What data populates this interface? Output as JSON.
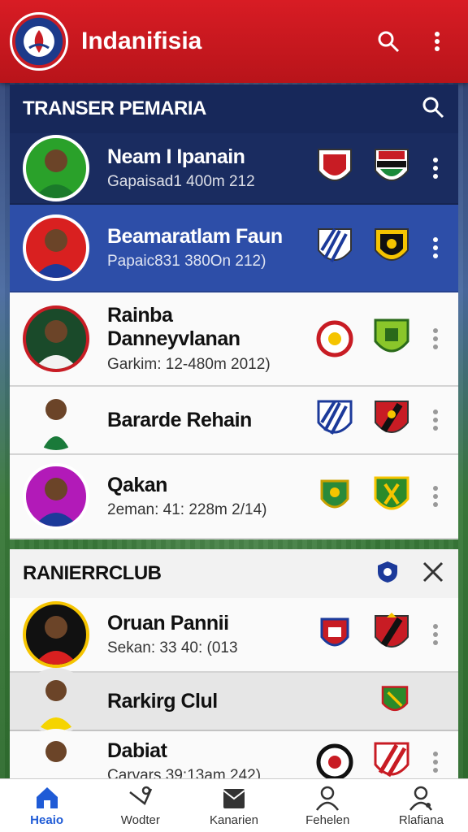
{
  "app": {
    "title": "Indanifisia",
    "colors": {
      "brand_red": "#d81c24",
      "navy": "#17285a",
      "active_blue": "#1f5bd6"
    }
  },
  "transfers": {
    "title": "TRANSER PEMARIA",
    "rows": [
      {
        "name": "Neam I Ipanain",
        "detail": "Gapaisad1 400m 212",
        "crests": [
          "club-crest-red-white",
          "club-crest-black-red"
        ]
      },
      {
        "name": "Beamaratlam Faun",
        "detail": "Papaic831 380On 212)",
        "crests": [
          "club-crest-blue-stripes",
          "club-crest-yellow-black"
        ]
      },
      {
        "name": "Rainba Danneyvlanan",
        "detail": "Garkim: 12-480m 2012)",
        "crests": [
          "club-crest-red-round",
          "club-crest-green-yellow"
        ]
      },
      {
        "name": "Bararde Rehain",
        "detail": "",
        "crests": [
          "club-crest-blue-stripes",
          "club-crest-red-black"
        ]
      },
      {
        "name": "Qakan",
        "detail": "2eman: 41: 228m 2/14)",
        "crests": [
          "club-crest-green-gold",
          "club-crest-green-yellow"
        ]
      }
    ]
  },
  "ranking": {
    "title": "RANIERRCLUB",
    "rows": [
      {
        "name": "Oruan Pannii",
        "detail": "Sekan: 33 40: (013",
        "crests": [
          "club-crest-red-blue",
          "club-crest-red-black"
        ]
      },
      {
        "name": "Rarkirg Clul",
        "detail": "",
        "crests": [
          "club-crest-green-red"
        ]
      },
      {
        "name": "Dabiat",
        "detail": "Carvars 39:13am 242)",
        "crests": [
          "club-crest-black-white",
          "club-crest-red-white-stripes"
        ]
      }
    ]
  },
  "nav": [
    {
      "label": "Heaio",
      "icon": "home-icon",
      "active": true
    },
    {
      "label": "Wodter",
      "icon": "whistle-icon",
      "active": false
    },
    {
      "label": "Kanarien",
      "icon": "inbox-icon",
      "active": false
    },
    {
      "label": "Fehelen",
      "icon": "person-icon",
      "active": false
    },
    {
      "label": "Rlafiana",
      "icon": "profile-icon",
      "active": false
    }
  ]
}
